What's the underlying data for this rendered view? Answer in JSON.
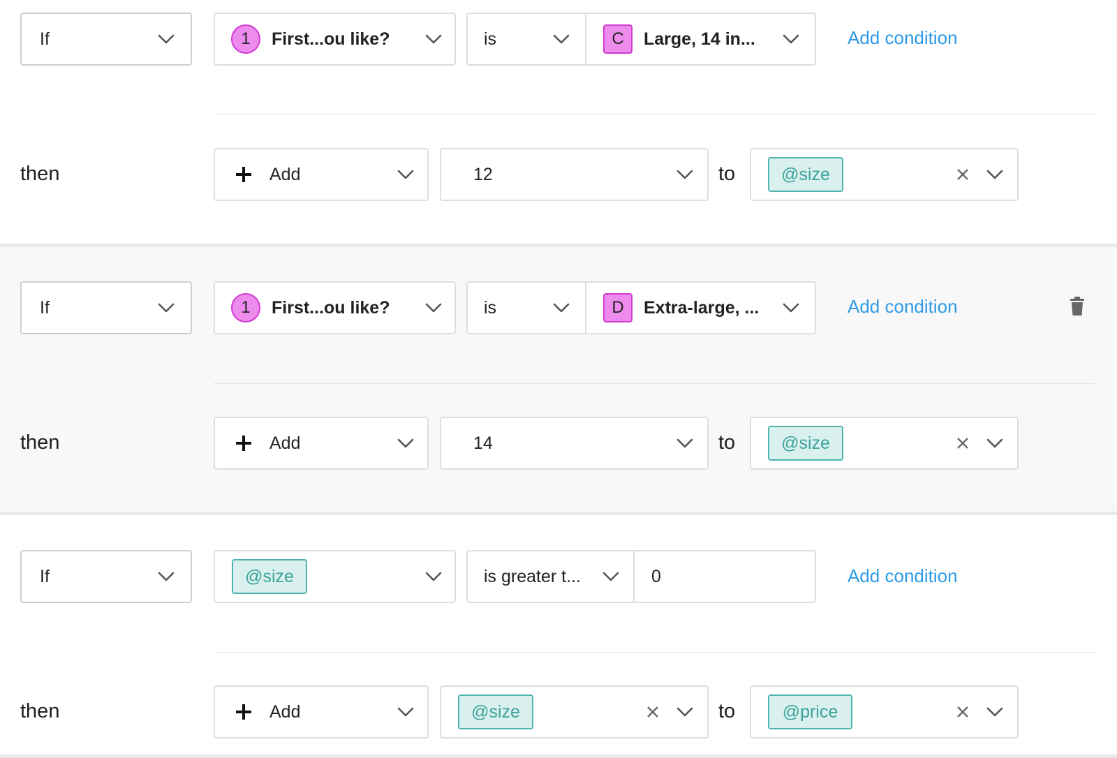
{
  "colors": {
    "accent_link": "#2c9ae6",
    "variable_text": "#3aa29b",
    "variable_fill": "#d9f0ee",
    "variable_border": "#4cb4ad",
    "choice_badge_fill": "#ee8cee",
    "choice_badge_border": "#d23bd2",
    "rule_shaded_bg": "#f8f8f8"
  },
  "icons": {
    "dropdown": "chevron-down-icon",
    "add": "plus-icon",
    "clear": "close-icon",
    "delete": "trash-icon"
  },
  "rules": [
    {
      "condition": {
        "keyword": "If",
        "field": {
          "badge": "1",
          "label": "First...ou like?"
        },
        "operator": "is",
        "value": {
          "badge": "C",
          "label": "Large, 14 in..."
        },
        "add_condition": "Add condition"
      },
      "action": {
        "keyword": "then",
        "verb": "Add",
        "amount": "12",
        "to": "to",
        "target": "@size"
      }
    },
    {
      "condition": {
        "keyword": "If",
        "field": {
          "badge": "1",
          "label": "First...ou like?"
        },
        "operator": "is",
        "value": {
          "badge": "D",
          "label": "Extra-large, ..."
        },
        "add_condition": "Add condition"
      },
      "action": {
        "keyword": "then",
        "verb": "Add",
        "amount": "14",
        "to": "to",
        "target": "@size"
      }
    },
    {
      "condition": {
        "keyword": "If",
        "field": {
          "variable": "@size"
        },
        "operator": "is greater t...",
        "value_text": "0",
        "add_condition": "Add condition"
      },
      "action": {
        "keyword": "then",
        "verb": "Add",
        "amount_variable": "@size",
        "to": "to",
        "target": "@price"
      }
    }
  ]
}
